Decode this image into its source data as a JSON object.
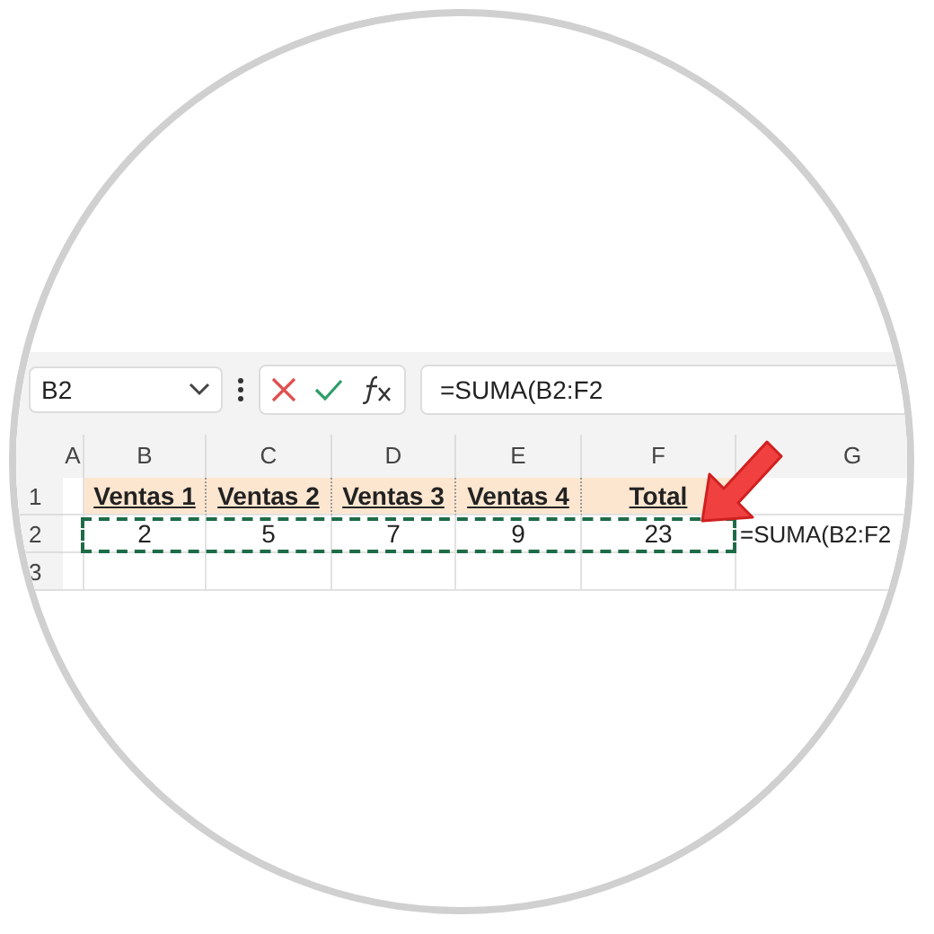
{
  "name_box": {
    "value": "B2"
  },
  "formula_bar": {
    "value": "=SUMA(B2:F2"
  },
  "columns": [
    "A",
    "B",
    "C",
    "D",
    "E",
    "F",
    "G"
  ],
  "heading_row": {
    "header": "1",
    "cells": [
      "Ventas 1",
      "Ventas 2",
      "Ventas 3",
      "Ventas 4",
      "Total"
    ]
  },
  "rows": [
    {
      "header": "2",
      "cells": [
        {
          "text": "2",
          "marquee": true
        },
        {
          "text": "5",
          "marquee": true
        },
        {
          "text": "7",
          "marquee": true
        },
        {
          "text": "9",
          "marquee": true
        },
        {
          "text": "23",
          "marquee": true
        },
        {
          "text": "=SUMA(B2:F2",
          "marquee": false
        }
      ]
    },
    {
      "header": "3",
      "cells": []
    }
  ]
}
